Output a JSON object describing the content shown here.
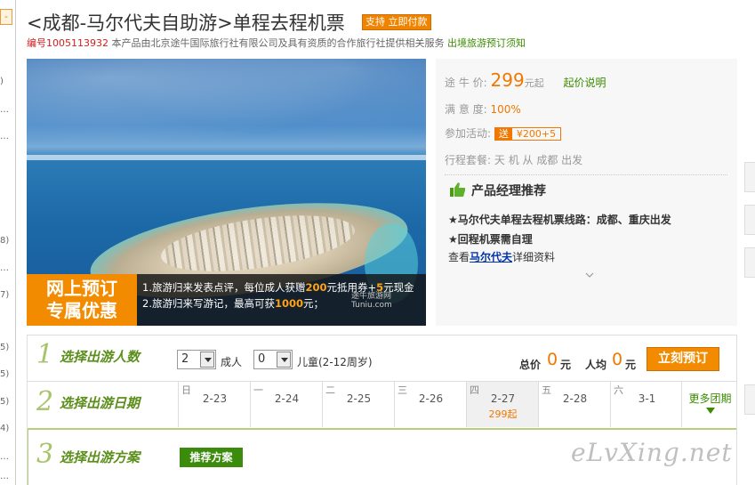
{
  "left_strip": {
    "top_button": "-",
    "fragments": [
      ")",
      "…",
      "…",
      "8)",
      "…",
      "7)",
      "5)",
      "5)",
      "5)",
      "4)",
      "…",
      "…"
    ]
  },
  "header": {
    "title": "<成都-马尔代夫自助游>单程去程机票",
    "badge": "支持 立即付款",
    "code": "编号1005113932",
    "description": "本产品由北京途牛国际旅行社有限公司及具有资质的合作旅行社提供相关服务",
    "notice_link": "出境旅游预订须知"
  },
  "hero": {
    "promo_title_line1": "网上预订",
    "promo_title_line2": "专属优惠",
    "line1_a": "1.旅游归来发表点评，每位成人获赠",
    "line1_b": "200",
    "line1_c": "元抵用券+",
    "line1_d": "5",
    "line1_e": "元现金",
    "line2_a": "2.旅游归来写游记，最高可获",
    "line2_b": "1000",
    "line2_c": "元；",
    "logo_line1": "途牛旅游网",
    "logo_line2": "Tuniu.com"
  },
  "info": {
    "price_label": "途 牛 价:",
    "price_value": "299",
    "price_unit": "元起",
    "price_link": "起价说明",
    "satisfaction_label": "满 意 度:",
    "satisfaction_value": "100%",
    "activity_label": "参加活动:",
    "activity_song": "送",
    "activity_amount": "¥200+5",
    "package_label": "行程套餐:",
    "package_value": "天   机    从 成都 出发",
    "pm_title": "产品经理推荐",
    "pm_line1": "★马尔代夫单程去程机票线路：成都、重庆出发",
    "pm_line2": "★回程机票需自理",
    "pm_line3_prefix": "查看",
    "pm_line3_link": "马尔代夫",
    "pm_line3_suffix": "详细资料"
  },
  "step1": {
    "num": "1",
    "label": "选择出游人数",
    "adults_value": "2",
    "adults_label": "成人",
    "children_value": "0",
    "children_label": "儿童(2-12周岁)",
    "total_label": "总价",
    "total_value": "0",
    "total_unit": "元",
    "avg_label": "人均",
    "avg_value": "0",
    "avg_unit": "元",
    "book_button": "立刻预订"
  },
  "step2": {
    "num": "2",
    "label": "选择出游日期",
    "dates": [
      {
        "weekday": "日",
        "date": "2-23",
        "price": ""
      },
      {
        "weekday": "一",
        "date": "2-24",
        "price": ""
      },
      {
        "weekday": "二",
        "date": "2-25",
        "price": ""
      },
      {
        "weekday": "三",
        "date": "2-26",
        "price": ""
      },
      {
        "weekday": "四",
        "date": "2-27",
        "price": "299起"
      },
      {
        "weekday": "五",
        "date": "2-28",
        "price": ""
      },
      {
        "weekday": "六",
        "date": "3-1",
        "price": ""
      }
    ],
    "more": "更多团期"
  },
  "step3": {
    "num": "3",
    "label": "选择出游方案",
    "rec_button": "推荐方案"
  },
  "watermark": "eLvXing.net",
  "colors": {
    "accent_orange": "#f07800",
    "accent_green": "#3b8c00",
    "code_red": "#d21e1e"
  }
}
